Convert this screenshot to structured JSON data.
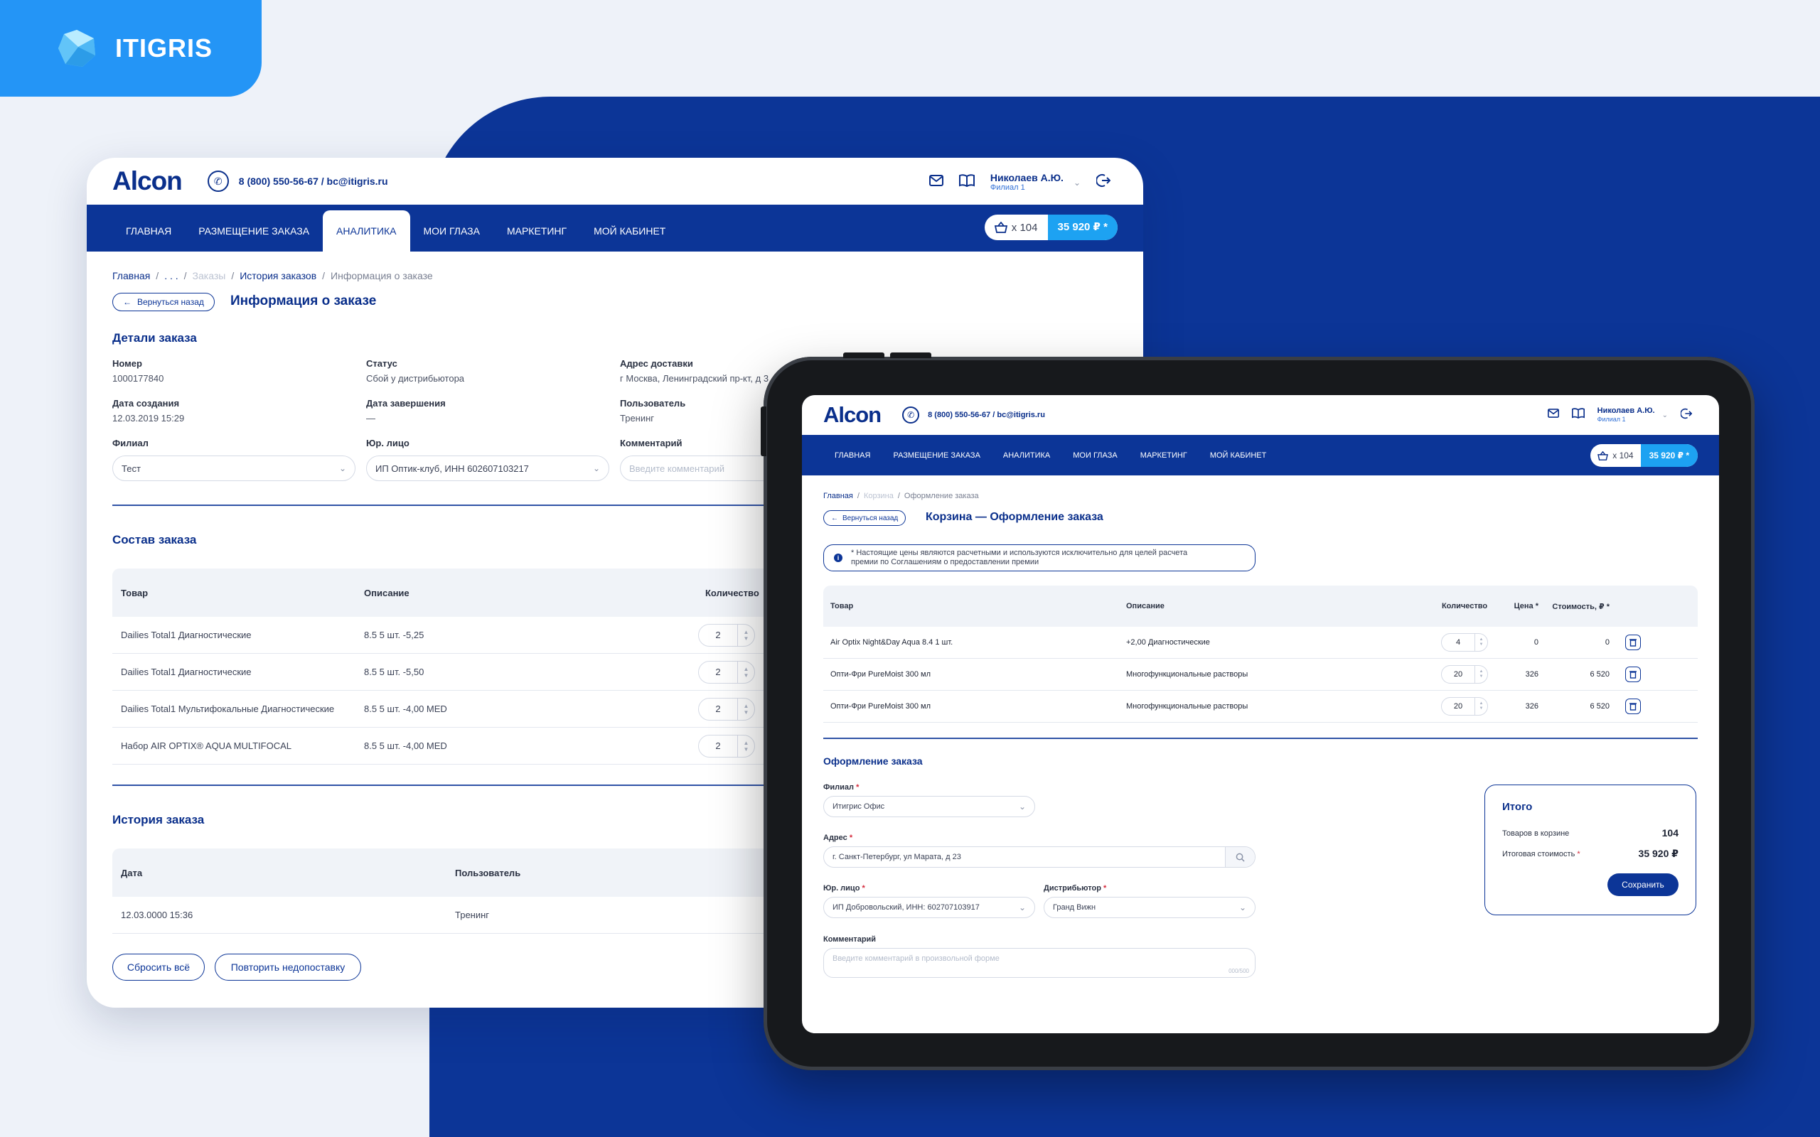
{
  "brand": {
    "name": "ITIGRIS"
  },
  "colors": {
    "primary": "#0c3597",
    "accent": "#1da2f2",
    "brand_bg": "#2495f6",
    "page_bg": "#eef2f9"
  },
  "desktop": {
    "logo": "Alcon",
    "contact": "8 (800) 550-56-67 / bc@itigris.ru",
    "user": {
      "name": "Николаев А.Ю.",
      "branch": "Филиал 1"
    },
    "nav": [
      "Главная",
      "Размещение заказа",
      "Аналитика",
      "Мои глаза",
      "Маркетинг",
      "Мой кабинет"
    ],
    "cart": {
      "count": "x 104",
      "sum": "35 920 ₽ *"
    },
    "breadcrumbs": {
      "home": "Главная",
      "ellipsis": ". . .",
      "orders": "Заказы",
      "history": "История заказов",
      "current": "Информация о заказе",
      "sep": "/"
    },
    "back": "Вернуться назад",
    "title": "Информация о заказе",
    "details": {
      "title": "Детали заказа",
      "number_label": "Номер",
      "number": "1000177840",
      "status_label": "Статус",
      "status": "Сбой у дистрибьютора",
      "address_label": "Адрес доставки",
      "address": "г Москва, Ленинградский пр-кт, д 3",
      "created_label": "Дата создания",
      "created": "12.03.2019 15:29",
      "finished_label": "Дата завершения",
      "finished": "—",
      "user_label": "Пользователь",
      "user": "Тренинг",
      "branch_label": "Филиал",
      "branch": "Тест",
      "legal_label": "Юр. лицо",
      "legal": "ИП Оптик-клуб, ИНН 602607103217",
      "comment_label": "Комментарий",
      "comment_placeholder": "Введите комментарий"
    },
    "composition": {
      "title": "Состав заказа",
      "headers": [
        "Товар",
        "Описание",
        "Количество"
      ],
      "rows": [
        {
          "product": "Dailies Total1 Диагностические",
          "desc": "8.5 5 шт. -5,25",
          "qty": "2"
        },
        {
          "product": "Dailies Total1 Диагностические",
          "desc": "8.5 5 шт. -5,50",
          "qty": "2"
        },
        {
          "product": "Dailies Total1 Мультифокальные Диагностические",
          "desc": "8.5 5 шт. -4,00 MED",
          "qty": "2"
        },
        {
          "product": "Набор AIR OPTIX® AQUA MULTIFOCAL",
          "desc": "8.5 5 шт. -4,00 MED",
          "qty": "2"
        }
      ]
    },
    "history": {
      "title": "История заказа",
      "headers": [
        "Дата",
        "Пользователь"
      ],
      "rows": [
        {
          "date": "12.03.0000 15:36",
          "user": "Тренинг"
        }
      ]
    },
    "actions": {
      "reset": "Сбросить всё",
      "repeat": "Повторить недопоставку"
    }
  },
  "tablet": {
    "logo": "Alcon",
    "contact": "8 (800) 550-56-67 / bc@itigris.ru",
    "user": {
      "name": "Николаев А.Ю.",
      "branch": "Филиал 1"
    },
    "nav": [
      "Главная",
      "Размещение заказа",
      "Аналитика",
      "Мои глаза",
      "Маркетинг",
      "Мой кабинет"
    ],
    "cart": {
      "count": "x 104",
      "sum": "35 920 ₽ *"
    },
    "breadcrumbs": {
      "home": "Главная",
      "cart": "Корзина",
      "current": "Оформление заказа",
      "sep": "/"
    },
    "back": "Вернуться назад",
    "title": "Корзина — Оформление заказа",
    "notice_line1": "* Настоящие цены являются расчетными и используются исключительно для целей расчета",
    "notice_line2": "премии по Соглашениям о предоставлении премии",
    "table": {
      "headers": [
        "Товар",
        "Описание",
        "Количество",
        "Цена *",
        "Стоимость, ₽ *"
      ],
      "rows": [
        {
          "product": "Air Optix Night&Day Aqua 8.4 1 шт.",
          "desc": "+2,00 Диагностические",
          "qty": "4",
          "price": "0",
          "cost": "0"
        },
        {
          "product": "Опти-Фри PureMoist 300 мл",
          "desc": "Многофункциональные растворы",
          "qty": "20",
          "price": "326",
          "cost": "6 520"
        },
        {
          "product": "Опти-Фри PureMoist 300 мл",
          "desc": "Многофункциональные растворы",
          "qty": "20",
          "price": "326",
          "cost": "6 520"
        }
      ]
    },
    "form": {
      "title": "Оформление заказа",
      "branch_label": "Филиал",
      "branch": "Итигрис Офис",
      "address_label": "Адрес",
      "address": "г. Санкт-Петербург, ул Марата, д 23",
      "legal_label": "Юр. лицо",
      "legal": "ИП Добровольский, ИНН: 602707103917",
      "distributor_label": "Дистрибьютор",
      "distributor": "Гранд Вижн",
      "comment_label": "Комментарий",
      "comment_placeholder": "Введите комментарий в произвольной форме",
      "counter": "000/500",
      "required_mark": "*"
    },
    "summary": {
      "title": "Итого",
      "items_label": "Товаров в корзине",
      "items": "104",
      "total_label": "Итоговая стоимость",
      "total": "35 920 ₽",
      "save": "Сохранить"
    }
  }
}
